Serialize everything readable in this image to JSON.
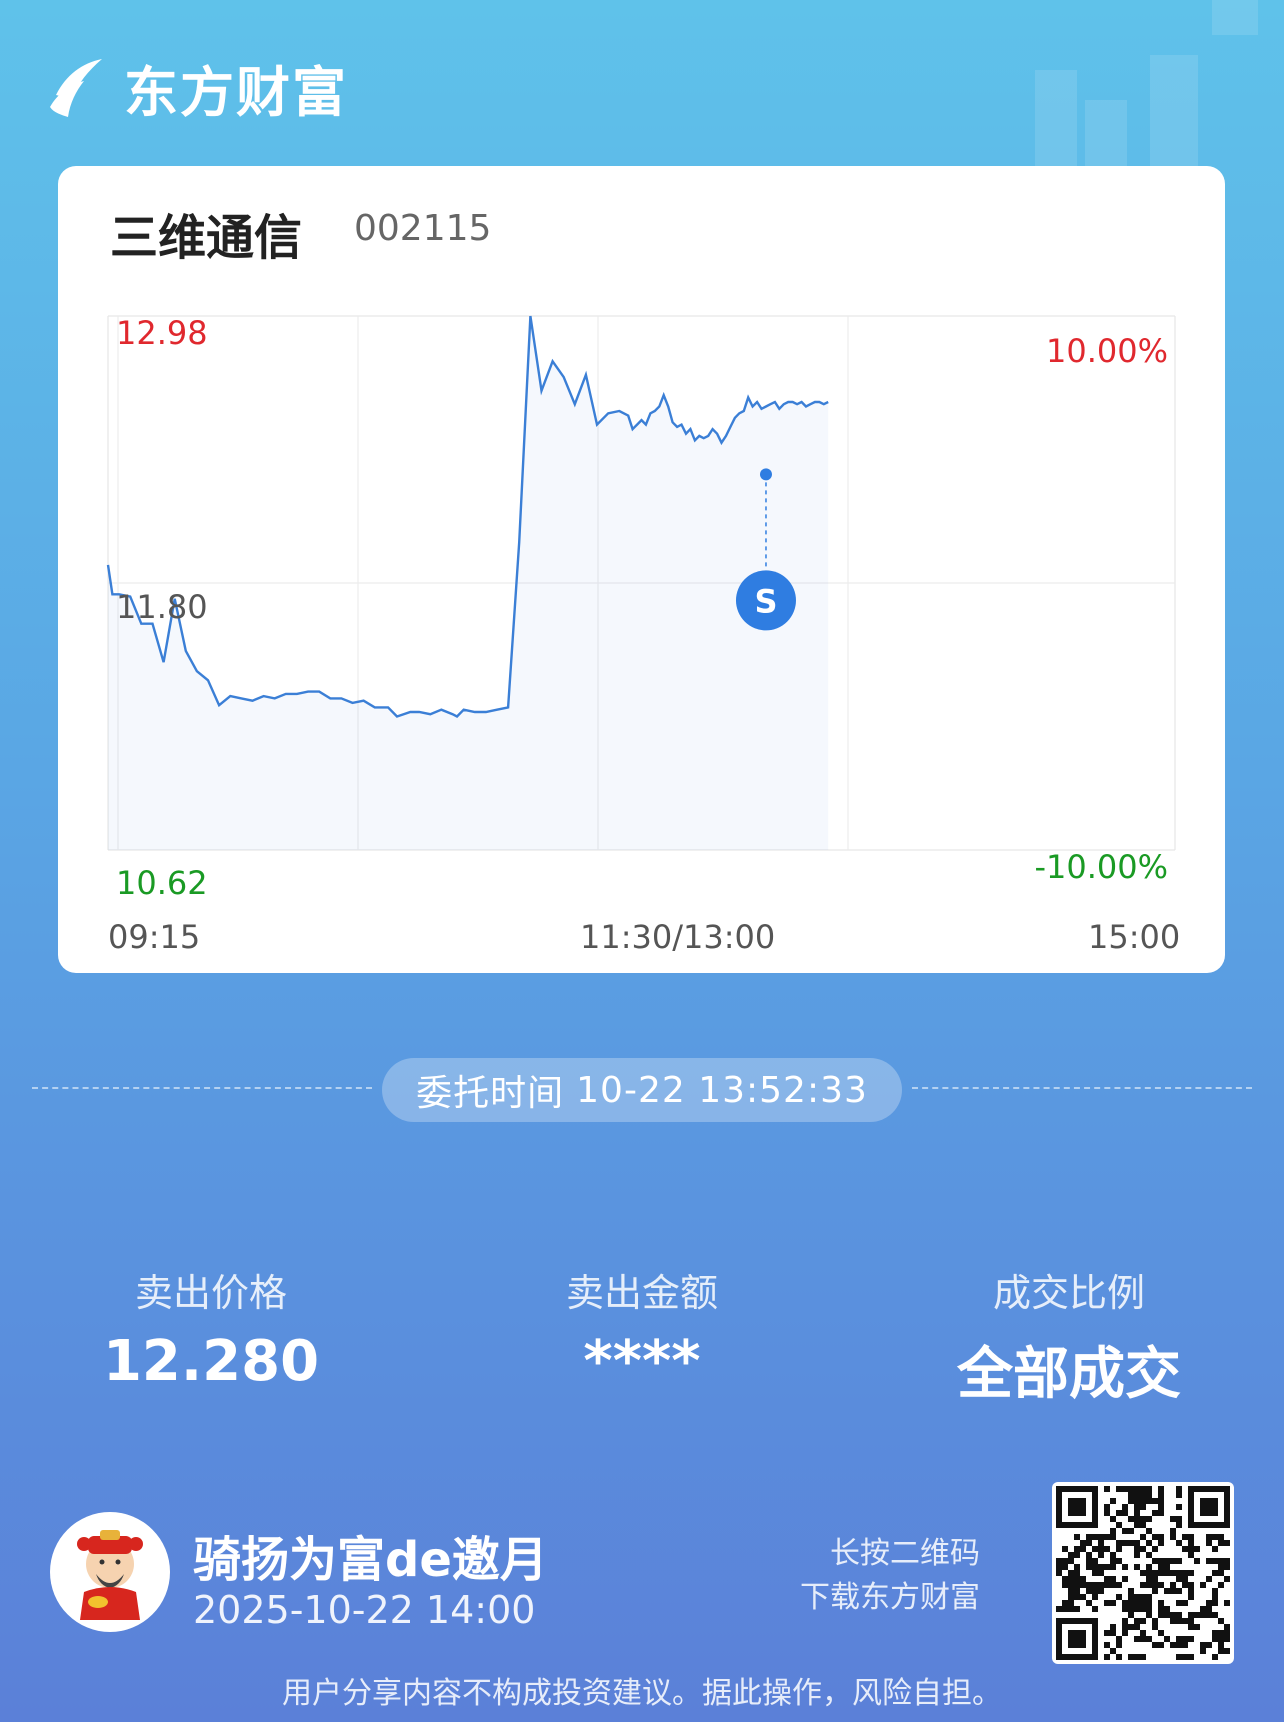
{
  "brand": {
    "name": "东方财富"
  },
  "stock": {
    "name": "三维通信",
    "code": "002115"
  },
  "chart_data": {
    "type": "line",
    "price_high_label": "12.98",
    "price_mid_label": "11.80",
    "price_low_label": "10.62",
    "pct_high_label": "10.00%",
    "pct_low_label": "-10.00%",
    "x_tick_labels": [
      "09:15",
      "11:30/13:00",
      "15:00"
    ],
    "ylim": [
      10.62,
      12.98
    ],
    "series": [
      {
        "x": [
          0,
          2,
          5,
          10,
          15,
          20,
          25,
          30,
          35,
          40,
          45,
          50,
          55,
          60,
          65,
          70,
          75,
          80,
          85,
          90,
          95,
          100,
          105,
          110,
          115,
          120,
          126,
          130,
          136,
          140,
          145,
          150,
          155,
          157,
          160,
          165,
          170,
          175,
          180,
          185,
          190,
          195,
          200,
          205,
          210,
          215,
          220,
          225,
          230,
          234,
          236,
          238,
          240,
          242,
          244,
          246,
          248,
          250,
          252,
          254,
          256,
          258,
          260,
          262,
          264,
          266,
          268,
          270,
          272,
          274,
          276,
          278,
          280,
          282,
          284,
          286,
          288,
          290,
          292,
          294,
          296,
          298,
          300,
          302,
          304,
          306,
          308,
          310,
          312,
          314,
          316,
          318,
          320,
          322,
          324
        ],
        "y": [
          11.88,
          11.75,
          11.75,
          11.74,
          11.62,
          11.62,
          11.45,
          11.73,
          11.5,
          11.41,
          11.37,
          11.26,
          11.3,
          11.29,
          11.28,
          11.3,
          11.29,
          11.31,
          11.31,
          11.32,
          11.32,
          11.29,
          11.29,
          11.27,
          11.28,
          11.25,
          11.25,
          11.21,
          11.23,
          11.23,
          11.22,
          11.24,
          11.22,
          11.21,
          11.24,
          11.23,
          11.23,
          11.24,
          11.25,
          11.98,
          12.98,
          12.65,
          12.78,
          12.71,
          12.59,
          12.72,
          12.5,
          12.55,
          12.56,
          12.54,
          12.48,
          12.5,
          12.52,
          12.5,
          12.55,
          12.56,
          12.58,
          12.63,
          12.58,
          12.51,
          12.49,
          12.5,
          12.46,
          12.48,
          12.43,
          12.45,
          12.44,
          12.45,
          12.48,
          12.46,
          12.42,
          12.45,
          12.49,
          12.53,
          12.55,
          12.56,
          12.62,
          12.58,
          12.6,
          12.57,
          12.58,
          12.59,
          12.6,
          12.57,
          12.59,
          12.6,
          12.6,
          12.59,
          12.6,
          12.58,
          12.59,
          12.6,
          12.6,
          12.59,
          12.6
        ]
      }
    ],
    "trade_marker": {
      "type": "S",
      "price": 12.28,
      "time": "13:52"
    }
  },
  "order": {
    "label": "委托时间",
    "datetime": "10-22 13:52:33"
  },
  "stats": [
    {
      "label": "卖出价格",
      "value": "12.280"
    },
    {
      "label": "卖出金额",
      "value": "****"
    },
    {
      "label": "成交比例",
      "value": "全部成交"
    }
  ],
  "user": {
    "name": "骑扬为富de邀月",
    "time": "2025-10-22 14:00"
  },
  "qr": {
    "line1": "长按二维码",
    "line2": "下载东方财富"
  },
  "footer": {
    "disclaimer": "用户分享内容不构成投资建议。据此操作，风险自担。"
  },
  "colors": {
    "up": "#e0282e",
    "down": "#1a9a24",
    "line": "#3b7fd6",
    "marker": "#2f7de1"
  }
}
